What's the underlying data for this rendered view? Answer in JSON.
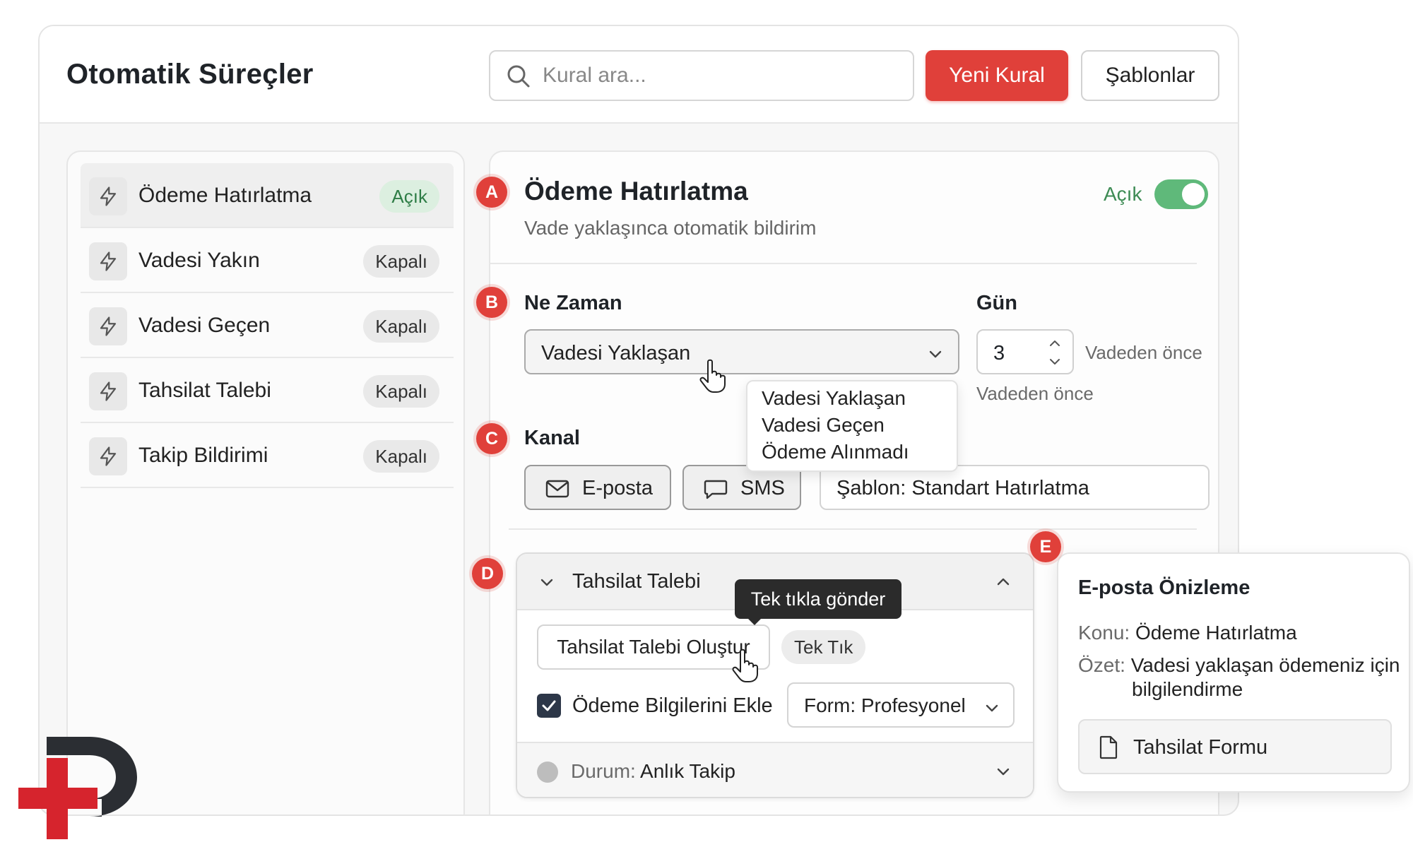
{
  "header": {
    "title": "Otomatik Süreçler",
    "search_placeholder": "Kural ara...",
    "new_rule_label": "Yeni Kural",
    "templates_label": "Şablonlar"
  },
  "sidebar": {
    "items": [
      {
        "label": "Ödeme Hatırlatma",
        "status": "Açık",
        "active": true
      },
      {
        "label": "Vadesi Yakın",
        "status": "Kapalı",
        "active": false
      },
      {
        "label": "Vadesi Geçen",
        "status": "Kapalı",
        "active": false
      },
      {
        "label": "Tahsilat Talebi",
        "status": "Kapalı",
        "active": false
      },
      {
        "label": "Takip Bildirimi",
        "status": "Kapalı",
        "active": false
      }
    ]
  },
  "markers": {
    "a": "A",
    "b": "B",
    "c": "C",
    "d": "D",
    "e": "E"
  },
  "detail": {
    "title": "Ödeme Hatırlatma",
    "subtitle": "Vade yaklaşınca otomatik bildirim",
    "toggle_label": "Açık",
    "toggle_on": true,
    "when": {
      "label": "Ne Zaman",
      "selected": "Vadesi Yaklaşan",
      "options": [
        "Vadesi Yaklaşan",
        "Vadesi Geçen",
        "Ödeme Alınmadı"
      ]
    },
    "day": {
      "label": "Gün",
      "value": "3",
      "suffix": "Vadeden önce",
      "helper": "Vadeden önce"
    },
    "channel": {
      "label": "Kanal",
      "email_label": "E-posta",
      "sms_label": "SMS",
      "template_value": "Şablon: Standart Hatırlatma"
    },
    "collection": {
      "title": "Tahsilat Talebi",
      "tooltip": "Tek tıkla gönder",
      "create_button": "Tahsilat Talebi Oluştur",
      "pill": "Tek Tık",
      "checkbox_label": "Ödeme Bilgilerini Ekle",
      "checkbox_checked": true,
      "form_select": "Form: Profesyonel",
      "status_key": "Durum:",
      "status_value": "Anlık Takip"
    }
  },
  "preview": {
    "title": "E-posta Önizleme",
    "subject_key": "Konu:",
    "subject_value": "Ödeme Hatırlatma",
    "summary_key": "Özet:",
    "summary_line1": "Vadesi yaklaşan ödemeniz için",
    "summary_line2": "bilgilendirme",
    "attachment": "Tahsilat Formu"
  },
  "colors": {
    "accent": "#e0403a",
    "success": "#5fb97a",
    "success_text": "#3d8b54",
    "logo_dark": "#2b2e33",
    "logo_red": "#d6242d"
  }
}
